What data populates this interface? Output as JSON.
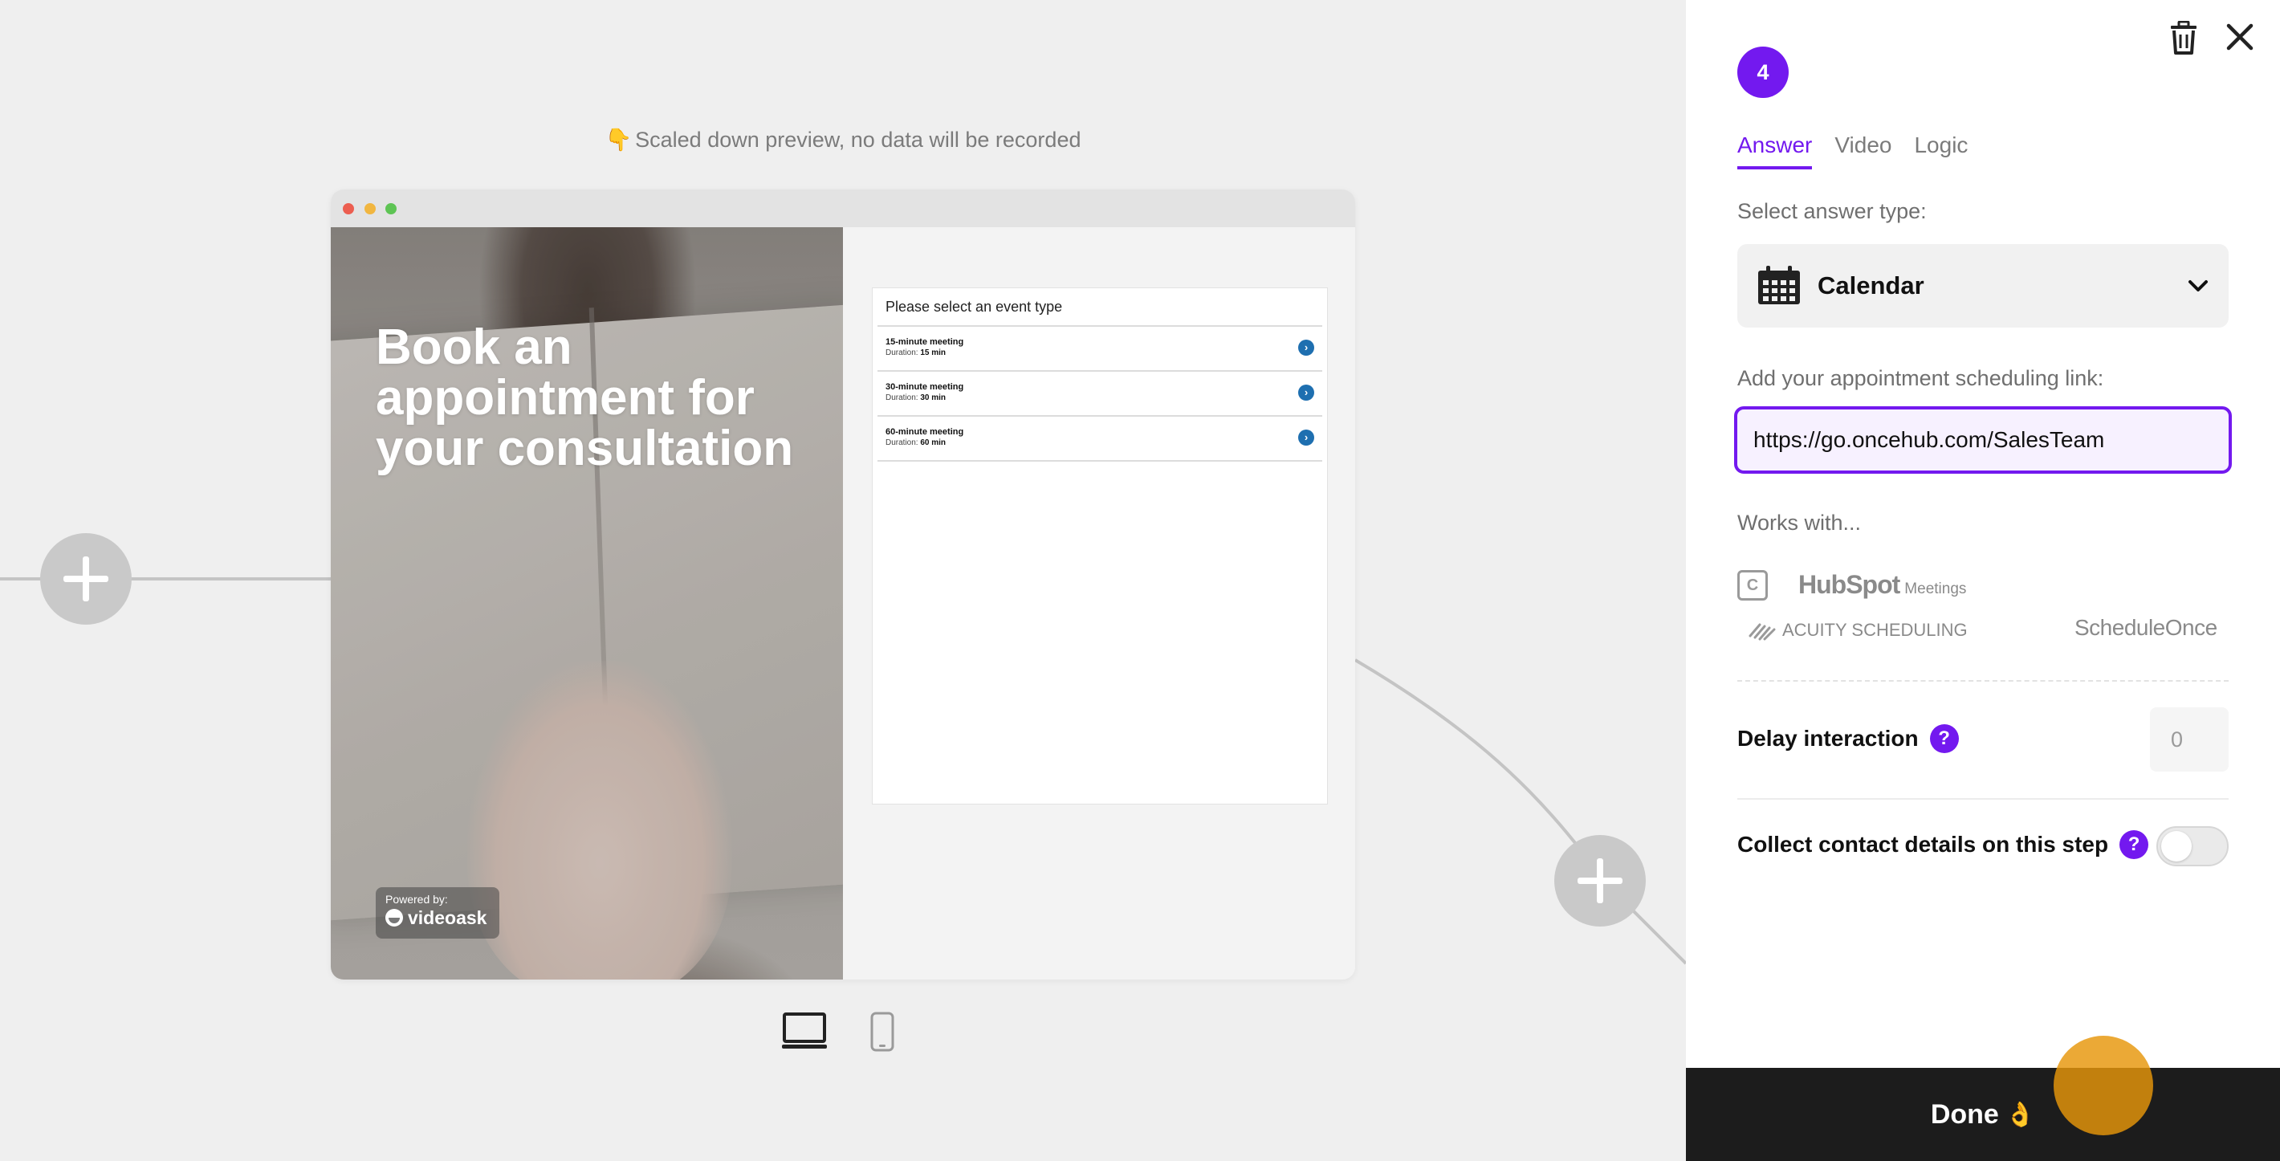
{
  "preview": {
    "note_icon": "👇",
    "note": "Scaled down preview, no data will be recorded",
    "headline": "Book an appointment for your consultation",
    "powered_by": "Powered by:",
    "brand": "videoask",
    "scheduler": {
      "heading": "Please select an event type",
      "duration_label": "Duration:",
      "events": [
        {
          "name": "15-minute meeting",
          "duration": "15 min"
        },
        {
          "name": "30-minute meeting",
          "duration": "30 min"
        },
        {
          "name": "60-minute meeting",
          "duration": "60 min"
        }
      ]
    },
    "device_icons": [
      "desktop-icon",
      "mobile-icon"
    ]
  },
  "panel": {
    "step_number": "4",
    "tabs": [
      {
        "label": "Answer",
        "active": true
      },
      {
        "label": "Video",
        "active": false
      },
      {
        "label": "Logic",
        "active": false
      }
    ],
    "answer_type_label": "Select answer type:",
    "answer_type_value": "Calendar",
    "link_label": "Add your appointment scheduling link:",
    "link_value": "https://go.oncehub.com/SalesTeam",
    "works_with_label": "Works with...",
    "works_with": {
      "calendly": "C",
      "hubspot": "HubSpot",
      "hubspot_sub": "Meetings",
      "acuity": "ACUITY SCHEDULING",
      "scheduleonce": "ScheduleOnce"
    },
    "delay_label": "Delay interaction",
    "delay_value": "0",
    "help_glyph": "?",
    "contact_label": "Collect contact details on this step",
    "contact_enabled": false,
    "done_label": "Done",
    "done_emoji": "👌"
  },
  "colors": {
    "accent": "#7319ef",
    "done_bar": "#1c1c1c",
    "canvas_bg": "#efefef",
    "link_blue": "#1e6fb0"
  }
}
